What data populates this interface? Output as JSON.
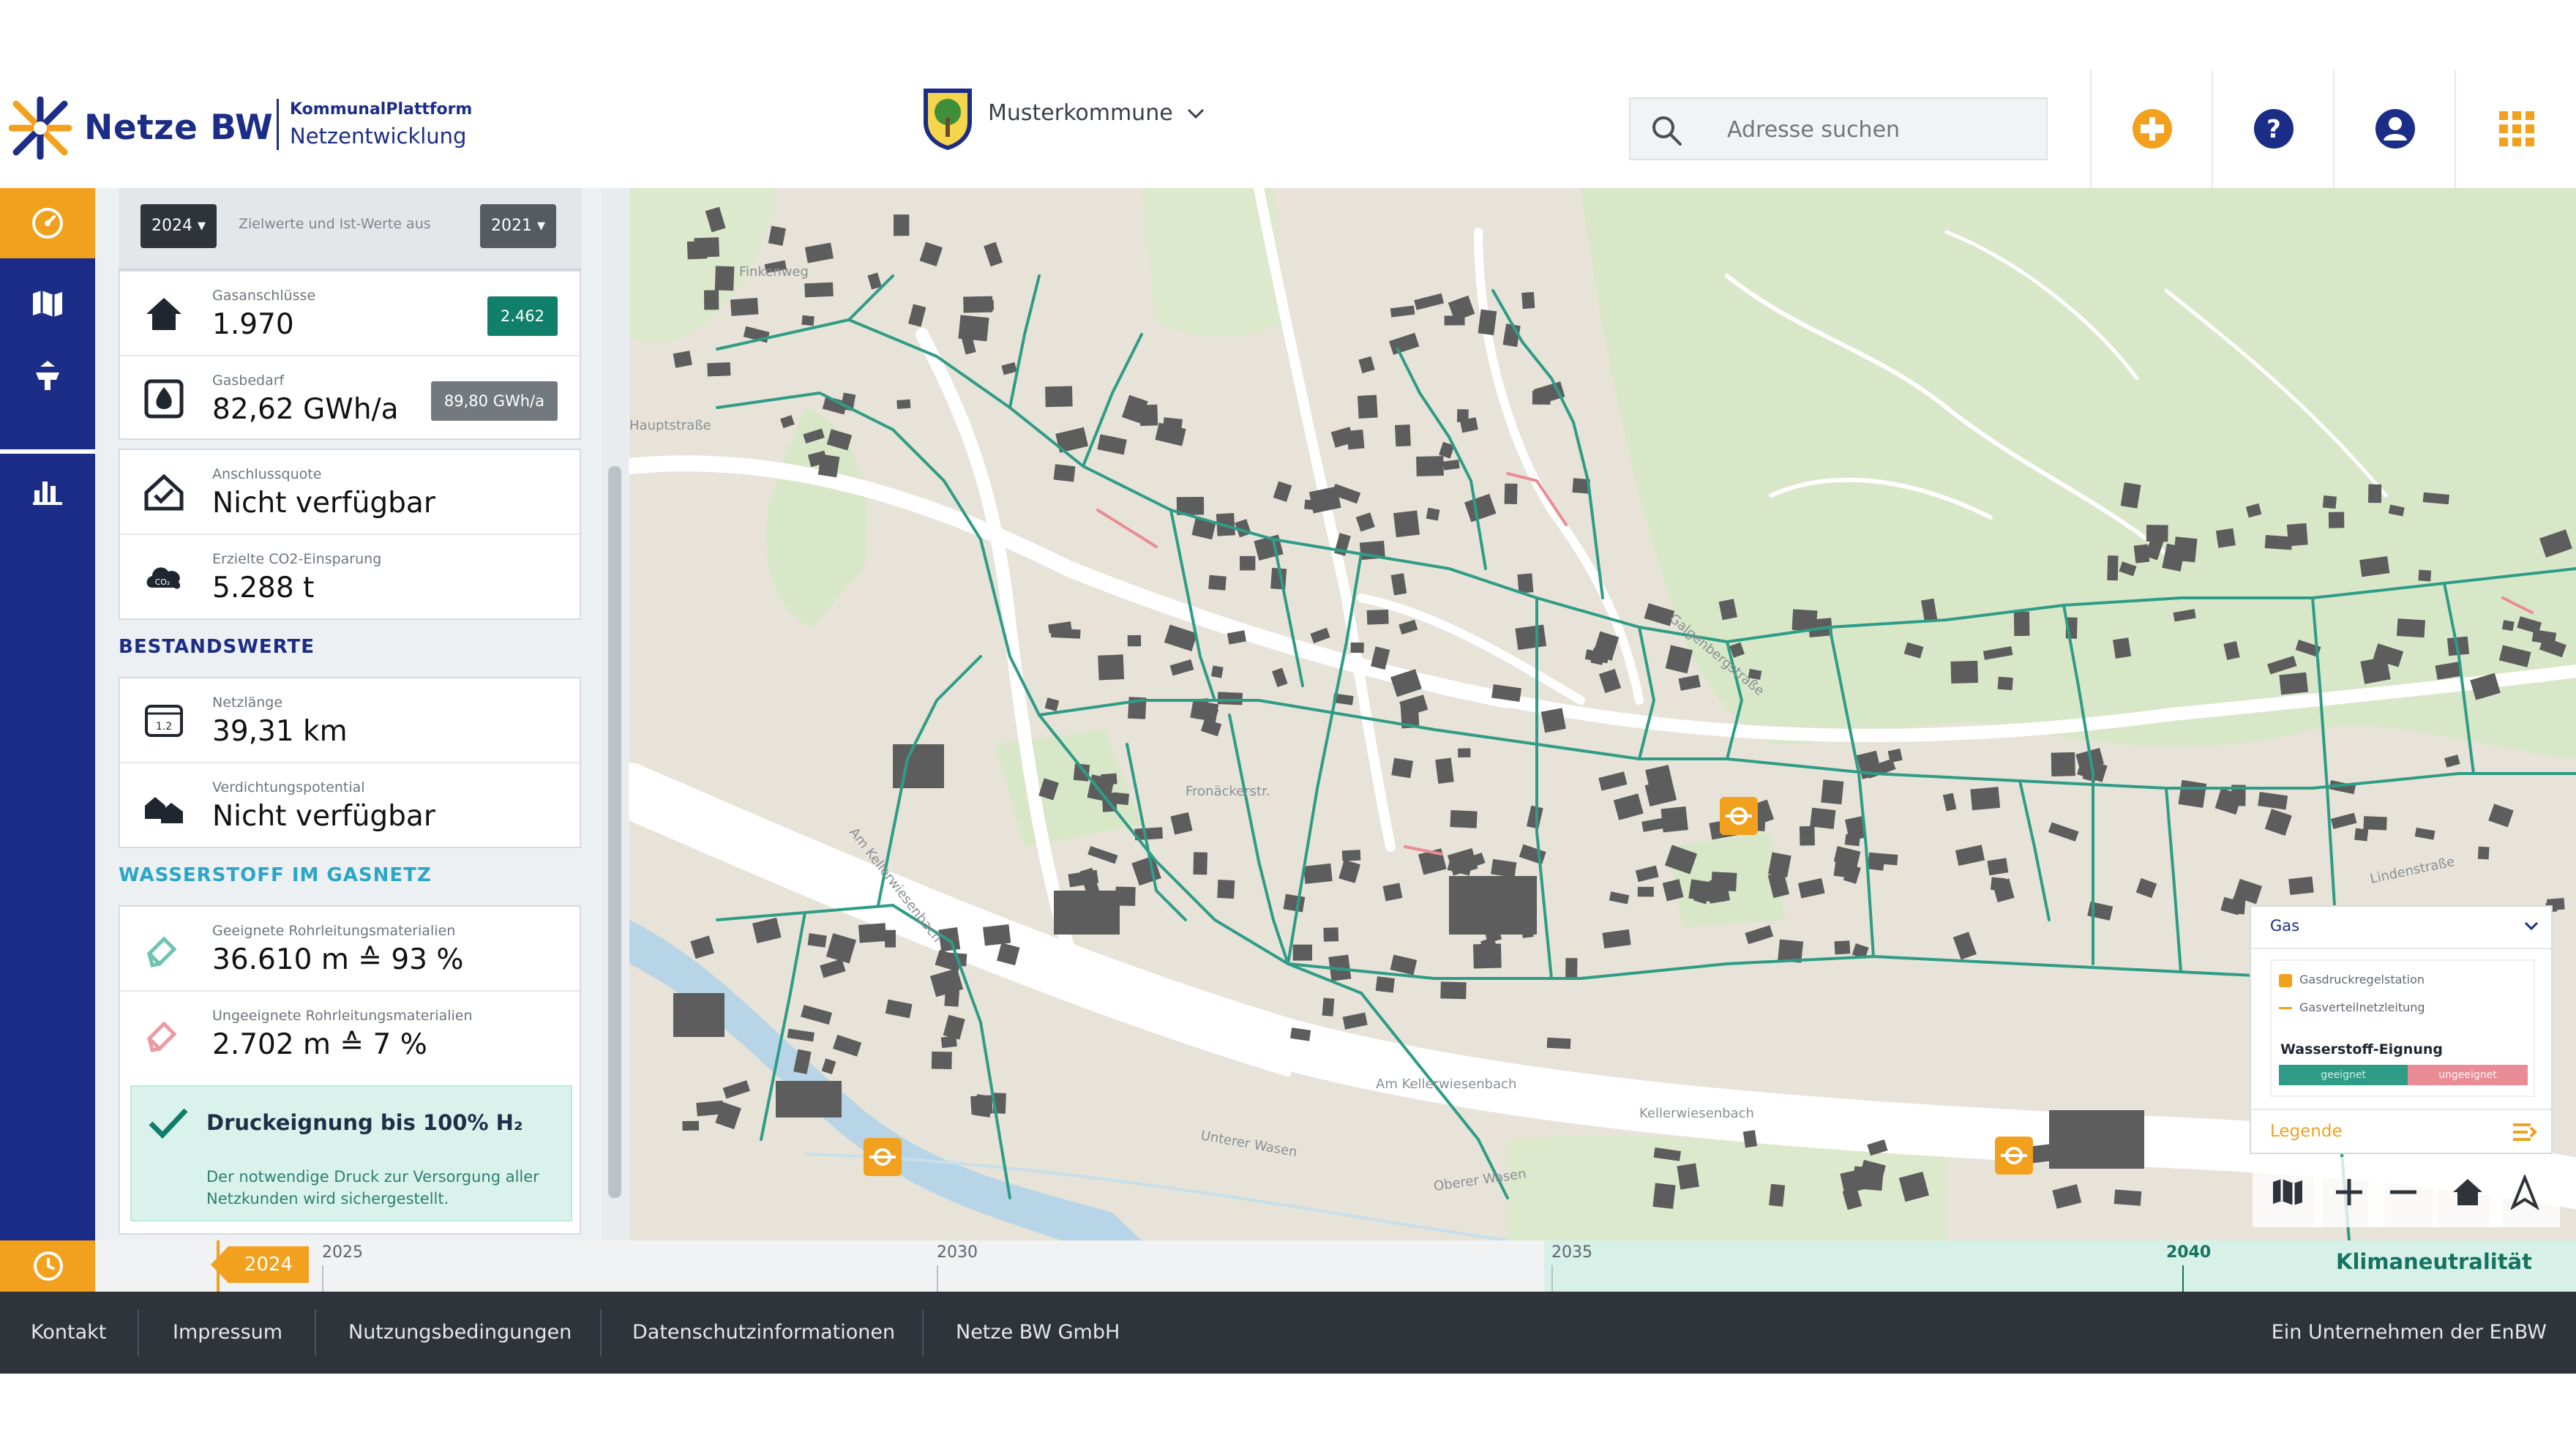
{
  "header": {
    "brand_name": "Netze BW",
    "brand_sub1": "KommunalPlattform",
    "brand_sub2": "Netzentwicklung",
    "municipality": "Musterkommune",
    "search_placeholder": "Adresse suchen",
    "icons": [
      "route-icon",
      "help-icon",
      "user-icon",
      "apps-grid-icon"
    ],
    "accent": "#f2a11f",
    "brand_color": "#1b2d86"
  },
  "rail": {
    "items": [
      "dashboard-icon",
      "map-icon",
      "upload-icon",
      "statistics-icon"
    ]
  },
  "panel": {
    "target_year": "2024",
    "compare_text": "Zielwerte und Ist-Werte aus",
    "compare_year": "2021",
    "kpis": [
      {
        "label": "Gasanschlüsse",
        "value": "1.970",
        "badge": "2.462"
      },
      {
        "label": "Gasbedarf",
        "value": "82,62 GWh/a",
        "badge": "89,80 GWh/a"
      },
      {
        "label": "Anschlussquote",
        "value": "Nicht verfügbar"
      },
      {
        "label": "Erzielte CO2-Einsparung",
        "value": "5.288 t"
      }
    ],
    "section_bestand": "BESTANDSWERTE",
    "bestand": [
      {
        "label": "Netzlänge",
        "value": "39,31 km"
      },
      {
        "label": "Verdichtungspotential",
        "value": "Nicht verfügbar"
      }
    ],
    "section_h2": "WASSERSTOFF IM GASNETZ",
    "h2": [
      {
        "label": "Geeignete Rohrleitungsmaterialien",
        "value": "36.610 m ≙ 93 %"
      },
      {
        "label": "Ungeeignete Rohrleitungsmaterialien",
        "value": "2.702 m ≙ 7 %"
      }
    ],
    "hint_title": "Druckeignung bis 100% H₂",
    "hint_text": "Der notwendige Druck zur Versorgung aller Netzkunden wird sichergestellt."
  },
  "map": {
    "street_labels": [
      "Finkenweg",
      "Fronäckerstr.",
      "Am Kellerwiesenbach",
      "Unterer Wasen",
      "Oberer Wasen",
      "Kellerwiesenbach",
      "Am Kellerwiesenbach",
      "Lindenstraße",
      "Hauptstraße",
      "Galgenbergstraße"
    ],
    "legend": {
      "title": "Gas",
      "items": [
        "Gasdruckregelstation",
        "Gasverteilnetzleitung"
      ],
      "h2_title": "Wasserstoff-Eignung",
      "suitable": "geeignet",
      "unsuitable": "ungeeignet",
      "footer": "Legende"
    },
    "tools": [
      "basemap-icon",
      "zoom-in-icon",
      "zoom-out-icon",
      "home-icon",
      "north-arrow-icon"
    ],
    "network_color": "#2e9c86",
    "unsuitable_color": "#e98c95"
  },
  "timeline": {
    "current_year": "2024",
    "ticks": [
      "2025",
      "2030",
      "2035",
      "2040"
    ],
    "goal": "Klimaneutralität"
  },
  "footer": {
    "links": [
      "Kontakt",
      "Impressum",
      "Nutzungsbedingungen",
      "Datenschutzinformationen",
      "Netze BW GmbH"
    ],
    "right": "Ein Unternehmen der EnBW"
  }
}
